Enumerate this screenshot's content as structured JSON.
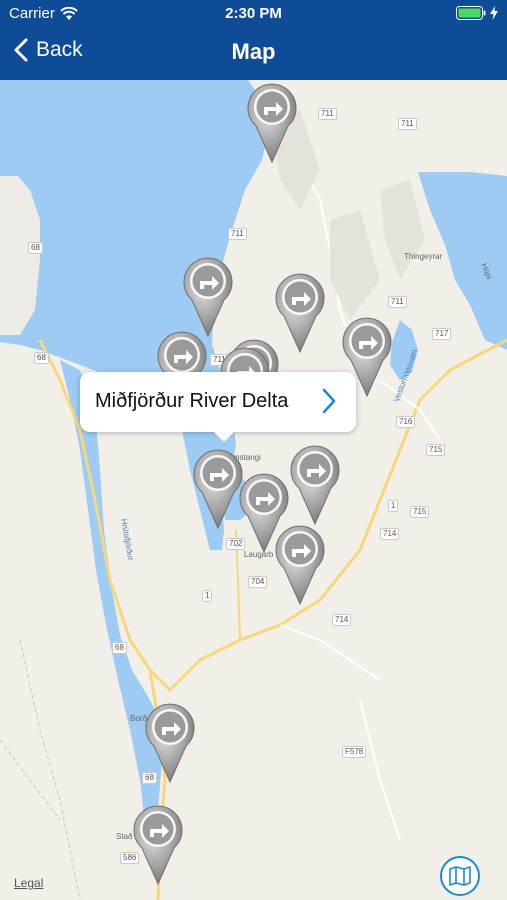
{
  "status_bar": {
    "carrier": "Carrier",
    "time": "2:30 PM"
  },
  "nav": {
    "back_label": "Back",
    "title": "Map"
  },
  "map": {
    "callout_label": "Miðfjörður River Delta",
    "legal": "Legal",
    "road_shields": [
      "711",
      "711",
      "711",
      "711",
      "68",
      "68",
      "711",
      "717",
      "716",
      "715",
      "1",
      "715",
      "714",
      "702",
      "704",
      "1",
      "714",
      "68",
      "68",
      "F578",
      "586"
    ],
    "places": [
      "Thingeyrar",
      "Hópi",
      "Vesturhópsvatn",
      "Hvammstangi",
      "Laugarb",
      "Hrútafjörður",
      "Borð",
      "Stað"
    ]
  },
  "colors": {
    "nav_bg": "#0e4c97",
    "water": "#9ecbf3",
    "land": "#f2efe9",
    "road": "#f7d77c",
    "pin": "#9a9a9a",
    "accent": "#1b8ad6"
  }
}
